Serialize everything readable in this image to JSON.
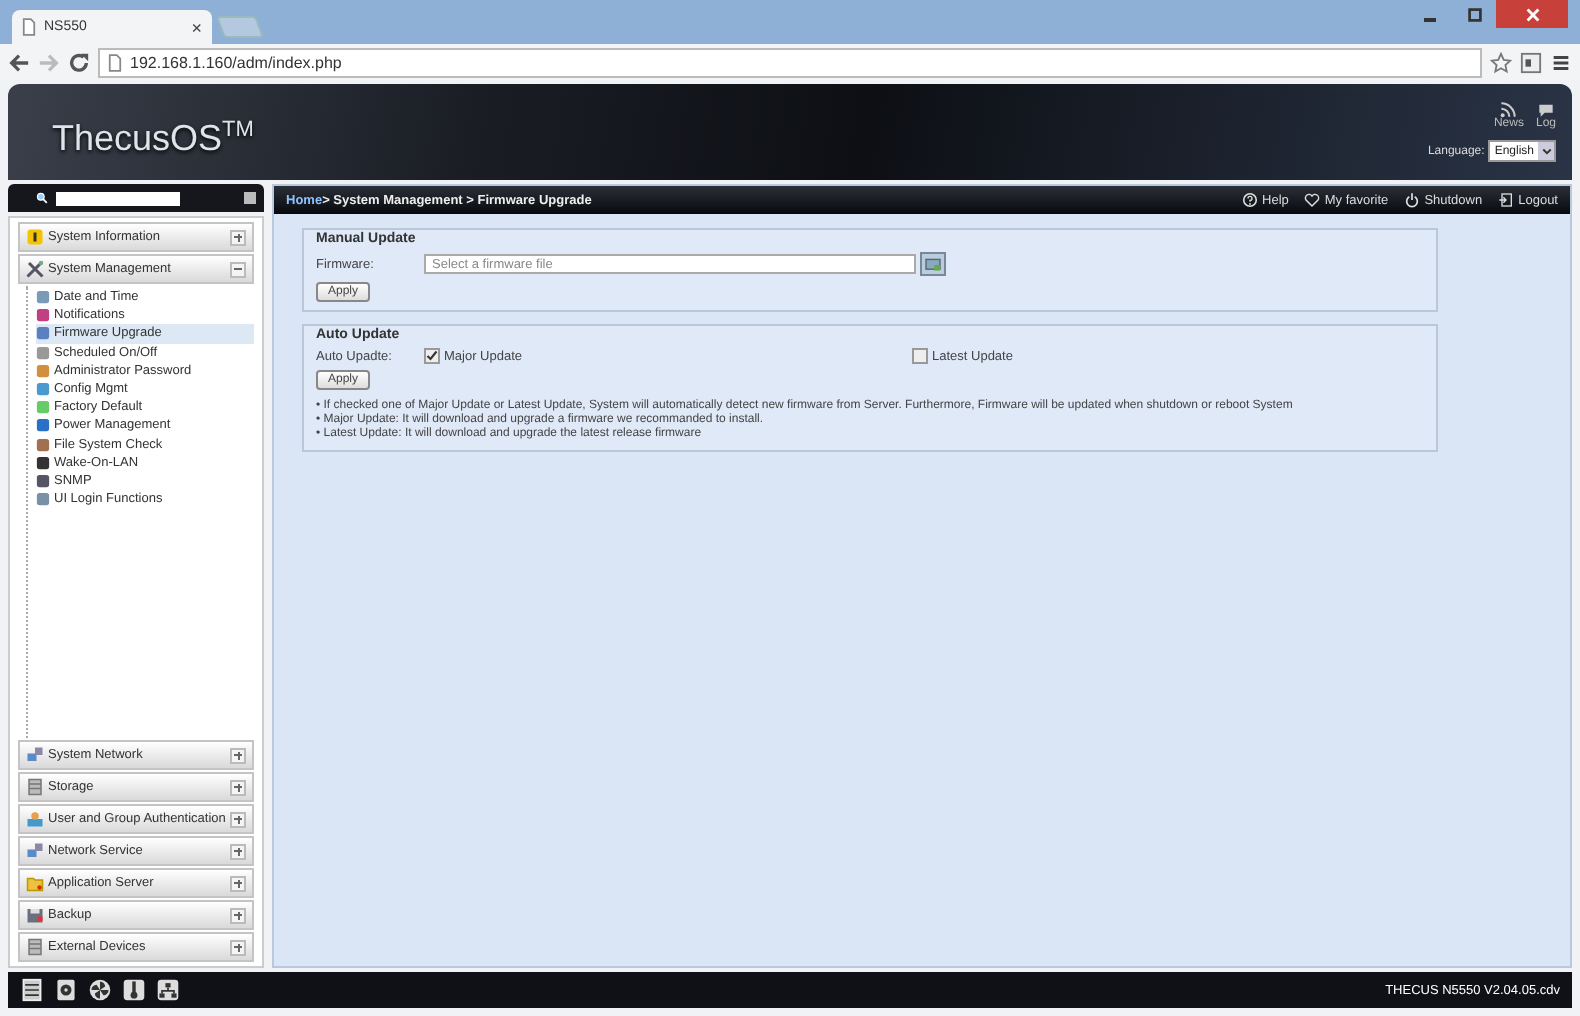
{
  "browser": {
    "tab": {
      "title": "NS550",
      "close": "×"
    },
    "url": "192.168.1.160/adm/index.php"
  },
  "header": {
    "logo": "ThecusOS$^{TM}$",
    "links": [
      {
        "kind": "news",
        "label": "News"
      },
      {
        "kind": "log",
        "label": "Log"
      }
    ],
    "language_label": "Language:",
    "language": "English"
  },
  "sidebar": {
    "sections": [
      {
        "title": "System Information",
        "kind": "info",
        "expanded": false
      },
      {
        "title": "System Management",
        "kind": "tools",
        "expanded": true,
        "items": [
          {
            "label": "Date and Time",
            "selected": false
          },
          {
            "label": "Notifications",
            "selected": false
          },
          {
            "label": "Firmware Upgrade",
            "selected": true
          },
          {
            "label": "Scheduled On/Off",
            "selected": false
          },
          {
            "label": "Administrator Password",
            "selected": false
          },
          {
            "label": "Config Mgmt",
            "selected": false
          },
          {
            "label": "Factory Default",
            "selected": false
          },
          {
            "label": "Power Management",
            "selected": false
          },
          {
            "label": "File System Check",
            "selected": false
          },
          {
            "label": "Wake-On-LAN",
            "selected": false
          },
          {
            "label": "SNMP",
            "selected": false
          },
          {
            "label": "UI Login Functions",
            "selected": false
          }
        ]
      },
      {
        "title": "System Network",
        "kind": "network",
        "expanded": false
      },
      {
        "title": "Storage",
        "kind": "storage",
        "expanded": false
      },
      {
        "title": "User and Group Authentication",
        "kind": "users",
        "expanded": false
      },
      {
        "title": "Network Service",
        "kind": "network",
        "expanded": false
      },
      {
        "title": "Application Server",
        "kind": "folder",
        "expanded": false
      },
      {
        "title": "Backup",
        "kind": "backup",
        "expanded": false
      },
      {
        "title": "External Devices",
        "kind": "storage",
        "expanded": false
      }
    ]
  },
  "breadcrumb": {
    "home": "Home",
    "path": " > System Management > Firmware Upgrade"
  },
  "toolbar": [
    {
      "kind": "help",
      "label": "Help"
    },
    {
      "kind": "favorite",
      "label": "My favorite"
    },
    {
      "kind": "shutdown",
      "label": "Shutdown"
    },
    {
      "kind": "logout",
      "label": "Logout"
    }
  ],
  "manual_update": {
    "title": "Manual Update",
    "field_label": "Firmware:",
    "placeholder": "Select a firmware file",
    "apply": "Apply"
  },
  "auto_update": {
    "title": "Auto Update",
    "field_label": "Auto Upadte:",
    "options": [
      {
        "label": "Major Update",
        "checked": true
      },
      {
        "label": "Latest Update",
        "checked": false
      }
    ],
    "apply": "Apply",
    "notes": [
      "• If checked one of Major Update or Latest Update, System will automatically detect new firmware from Server. Furthermore, Firmware will be updated when shutdown or reboot System",
      "• Major Update: It will download and upgrade a firmware we recommanded to install.",
      "• Latest Update: It will download and upgrade the latest release firmware"
    ]
  },
  "footer": {
    "version": "THECUS N5550 V2.04.05.cdv"
  }
}
